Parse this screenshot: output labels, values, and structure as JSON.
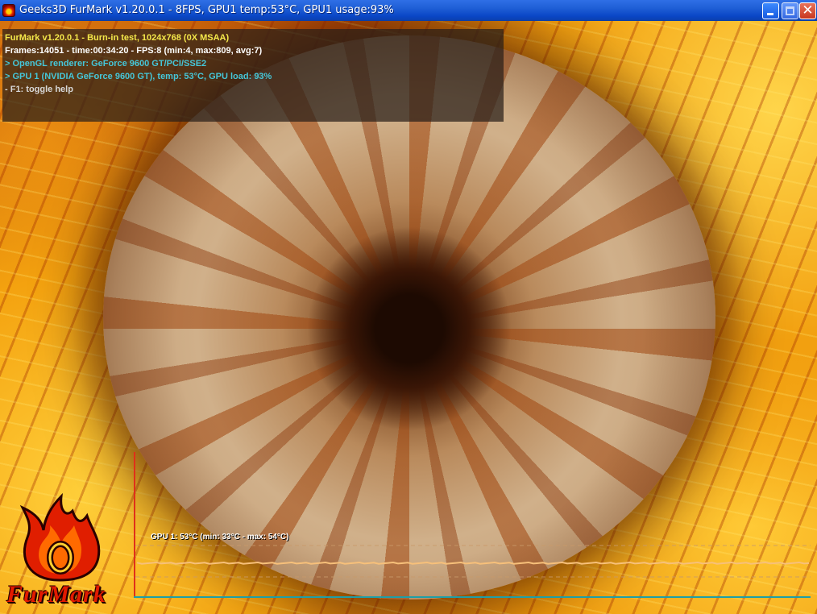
{
  "window": {
    "title": "Geeks3D FurMark v1.20.0.1 - 8FPS, GPU1 temp:53°C, GPU1 usage:93%",
    "controls": {
      "minimize": "minimize",
      "maximize": "maximize",
      "close": "close"
    }
  },
  "hud": {
    "lines": [
      "FurMark v1.20.0.1 - Burn-in test, 1024x768 (0X MSAA)",
      "Frames:14051 - time:00:34:20 - FPS:8 (min:4, max:809, avg:7)",
      "> OpenGL renderer: GeForce 9600 GT/PCI/SSE2",
      "> GPU 1 (NVIDIA GeForce 9600 GT), temp: 53°C, GPU load: 93%",
      "- F1: toggle help"
    ],
    "colors": {
      "title": "#f4e84a",
      "stats": "#ffffff",
      "info": "#45c6d8",
      "help": "#d8d8d8"
    }
  },
  "logo": {
    "text": "FurMark"
  },
  "gpu_graph": {
    "label": "GPU 1: 53°C (min: 33°C - max: 54°C)",
    "current_c": 53,
    "min_c": 33,
    "max_c": 54,
    "line_color": "#f7c07a",
    "axis_color": "#1e9fa8",
    "frame_color": "#e0301a"
  },
  "icons": [
    "furmark-app-icon",
    "minimize-icon",
    "maximize-icon",
    "close-icon",
    "furmark-flame-logo-icon"
  ]
}
